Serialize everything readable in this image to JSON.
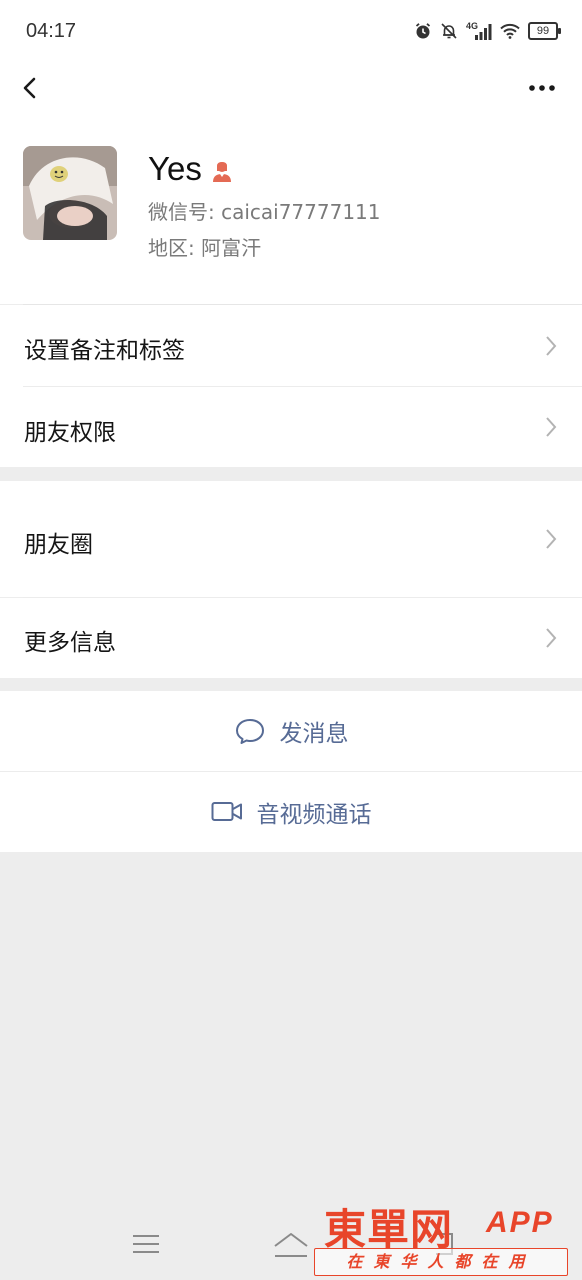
{
  "status_bar": {
    "time": "04:17",
    "network": "4G",
    "battery": "99",
    "icons": [
      "alarm-icon",
      "mute-bell-icon",
      "signal-icon",
      "wifi-icon",
      "battery-icon"
    ]
  },
  "nav": {
    "back_icon": "chevron-left-icon",
    "more_icon": "more-dots-icon"
  },
  "profile": {
    "name": "Yes",
    "gender_icon": "female-person-icon",
    "wechat_id": "微信号: caicai77777111",
    "region": "地区: 阿富汗"
  },
  "menu": {
    "remark_tags": "设置备注和标签",
    "friend_permissions": "朋友权限",
    "moments": "朋友圈",
    "more_info": "更多信息"
  },
  "actions": {
    "send_message": "发消息",
    "video_call": "音视频通话"
  },
  "colors": {
    "link_blue": "#576b95",
    "background": "#ededed",
    "gender_icon": "#e46a54",
    "watermark_red": "#e8452a"
  },
  "watermark": {
    "title": "東單网",
    "app": "APP",
    "tagline": "在東华人都在用"
  }
}
